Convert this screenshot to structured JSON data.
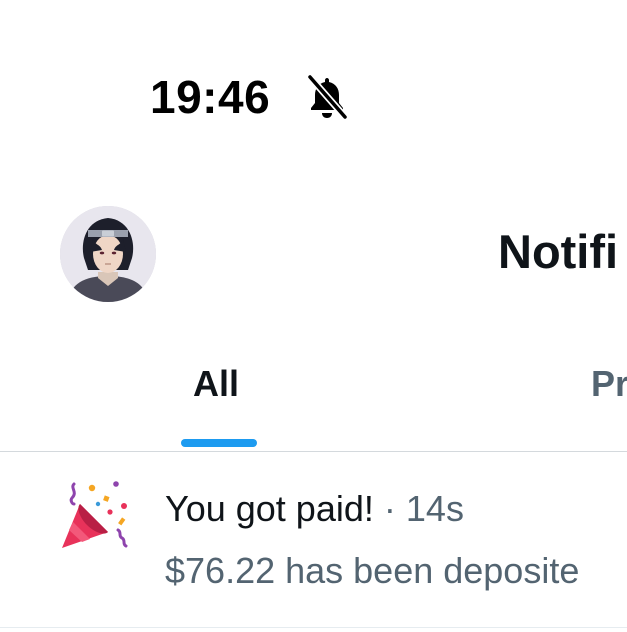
{
  "status_bar": {
    "time": "19:46",
    "silent_icon": "bell-slash-icon"
  },
  "header": {
    "avatar_icon": "user-avatar",
    "title": "Notifi"
  },
  "tabs": [
    {
      "label": "All",
      "selected": true
    },
    {
      "label": "Pr",
      "selected": false
    }
  ],
  "notification": {
    "icon": "party-popper-icon",
    "title": "You got paid!",
    "separator": "·",
    "time": "14s",
    "body": "$76.22 has been deposite"
  },
  "colors": {
    "accent": "#1d9bf0",
    "primary_text": "#0f1419",
    "secondary_text": "#536471",
    "divider": "#d4d9dd"
  }
}
